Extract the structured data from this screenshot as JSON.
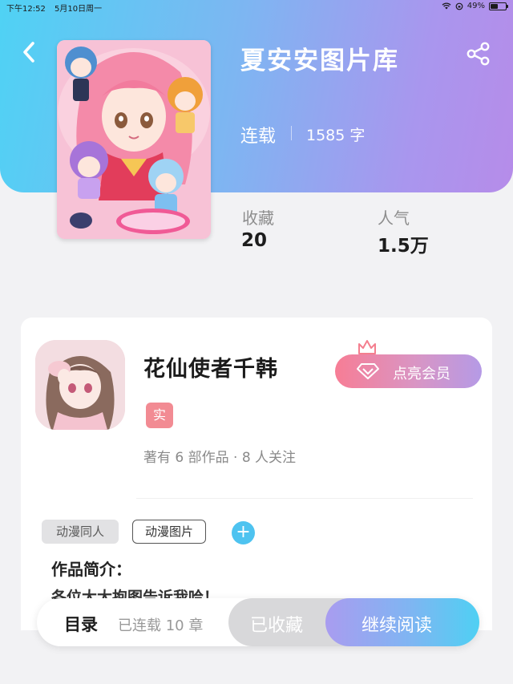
{
  "status_bar": {
    "time": "下午12:52",
    "date": "5月10日周一",
    "battery": "49%",
    "battery_level": 0.49,
    "icons": [
      "wifi-icon",
      "orientation-lock-icon",
      "battery-icon"
    ]
  },
  "header": {
    "back_icon": "chevron-left-icon",
    "share_icon": "share-icon",
    "gradient_colors": [
      "#4fd2f4",
      "#a996ee",
      "#b68ce9"
    ]
  },
  "book": {
    "title": "夏安安图片库",
    "status": "连载",
    "word_count": "1585 字",
    "stats": {
      "favorites_label": "收藏",
      "favorites_value": "20",
      "popularity_label": "人气",
      "popularity_value": "1.5万"
    }
  },
  "author": {
    "name": "花仙使者千韩",
    "verified_badge": "实",
    "stats": "著有 6 部作品 · 8 人关注",
    "vip_button": "点亮会员",
    "vip_icons": [
      "crown-icon",
      "diamond-icon"
    ]
  },
  "tags": {
    "items": [
      "动漫同人",
      "动漫图片"
    ],
    "add_label": "+"
  },
  "intro": {
    "title": "作品简介：",
    "text": "各位大大抱图告诉我哈！"
  },
  "bottom_bar": {
    "toc_label": "目录",
    "chapter_count": "已连载 10 章",
    "favorite_button": "已收藏",
    "read_button": "继续阅读"
  },
  "colors": {
    "accent_blue": "#4ec3f0",
    "accent_purple": "#a99cf0",
    "vip_pink": "#f77d95",
    "badge_red": "#f28b93"
  }
}
